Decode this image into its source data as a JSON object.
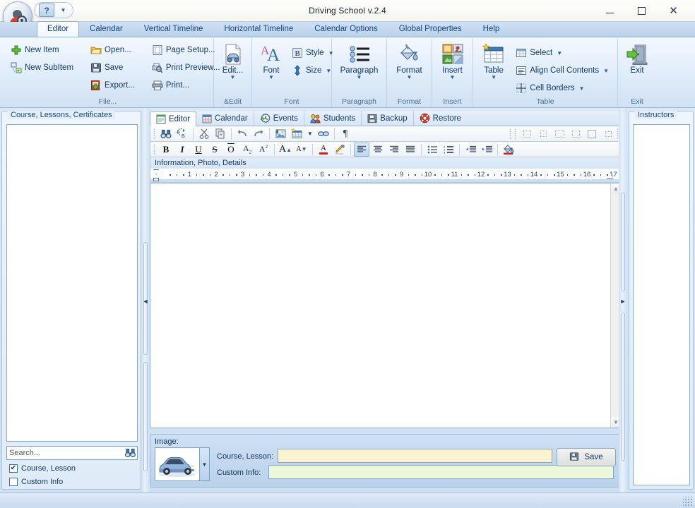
{
  "window": {
    "title": "Driving School v.2.4",
    "orb_icon": "app-orb-icon",
    "qat": {
      "help_label": "?",
      "help_icon": "help-icon",
      "dropdown_icon": "chevron-down-icon"
    },
    "controls": {
      "minimize": "Minimize",
      "maximize": "Maximize",
      "close": "Close"
    }
  },
  "ribbon": {
    "tabs": [
      {
        "label": "Editor",
        "active": true
      },
      {
        "label": "Calendar",
        "active": false
      },
      {
        "label": "Vertical Timeline",
        "active": false
      },
      {
        "label": "Horizontal Timeline",
        "active": false
      },
      {
        "label": "Calendar Options",
        "active": false
      },
      {
        "label": "Global Properties",
        "active": false
      },
      {
        "label": "Help",
        "active": false
      }
    ],
    "groups": [
      {
        "title": "File...",
        "col1": [
          {
            "label": "New Item",
            "icon": "plus-icon"
          },
          {
            "label": "New SubItem",
            "icon": "subitem-icon"
          }
        ],
        "col2": [
          {
            "label": "Open...",
            "icon": "folder-open-icon"
          },
          {
            "label": "Save",
            "icon": "floppy-disk-icon"
          },
          {
            "label": "Export...",
            "icon": "export-icon"
          }
        ],
        "col3": [
          {
            "label": "Page Setup...",
            "icon": "page-setup-icon"
          },
          {
            "label": "Print Preview...",
            "icon": "print-preview-icon"
          },
          {
            "label": "Print...",
            "icon": "printer-icon"
          }
        ]
      },
      {
        "title": "&Edit",
        "big": [
          {
            "label": "Edit...",
            "icon": "edit-document-icon",
            "split": true
          }
        ]
      },
      {
        "title": "Font",
        "big": [
          {
            "label": "Font",
            "icon": "font-AA-icon",
            "split": true
          }
        ],
        "col2": [
          {
            "label": "Style",
            "icon": "style-B-icon",
            "caret": true
          },
          {
            "label": "Size",
            "icon": "size-arrows-icon",
            "caret": true
          }
        ]
      },
      {
        "title": "Paragraph",
        "big": [
          {
            "label": "Paragraph",
            "icon": "paragraph-list-icon",
            "split": true
          }
        ]
      },
      {
        "title": "Format",
        "big": [
          {
            "label": "Format",
            "icon": "paint-bucket-icon",
            "split": true
          }
        ]
      },
      {
        "title": "Insert",
        "big": [
          {
            "label": "Insert",
            "icon": "insert-objects-icon",
            "split": true
          }
        ]
      },
      {
        "title": "Table",
        "big": [
          {
            "label": "Table",
            "icon": "table-grid-icon",
            "split": true
          }
        ],
        "col2": [
          {
            "label": "Select",
            "icon": "select-table-icon",
            "caret": true
          },
          {
            "label": "Align Cell Contents",
            "icon": "align-cell-icon",
            "caret": true
          },
          {
            "label": "Cell Borders",
            "icon": "cell-borders-icon",
            "caret": true
          }
        ]
      },
      {
        "title": "Exit",
        "big": [
          {
            "label": "Exit",
            "icon": "exit-door-icon",
            "split": false
          }
        ]
      }
    ]
  },
  "left_panel": {
    "title": "Course, Lessons, Certificates",
    "search": {
      "placeholder": "Search...",
      "value": "",
      "icon": "binoculars-icon"
    },
    "checkboxes": [
      {
        "label": "Course, Lesson",
        "checked": true,
        "mark": "✔"
      },
      {
        "label": "Custom Info",
        "checked": false,
        "mark": ""
      }
    ]
  },
  "right_panel": {
    "title": "Instructors"
  },
  "splitters": {
    "left_arrow": "◄",
    "right_arrow": "►"
  },
  "center": {
    "tabs": [
      {
        "label": "Editor",
        "icon": "editor-icon",
        "active": true
      },
      {
        "label": "Calendar",
        "icon": "calendar-icon",
        "active": false
      },
      {
        "label": "Events",
        "icon": "events-clock-icon",
        "active": false
      },
      {
        "label": "Students",
        "icon": "students-icon",
        "active": false
      },
      {
        "label": "Backup",
        "icon": "backup-floppy-icon",
        "active": false
      },
      {
        "label": "Restore",
        "icon": "restore-lifering-icon",
        "active": false
      }
    ],
    "toolbar_row1": [
      {
        "name": "find-icon",
        "title": "Find"
      },
      {
        "name": "replace-icon",
        "title": "Replace"
      },
      {
        "sep": true
      },
      {
        "name": "cut-icon",
        "title": "Cut"
      },
      {
        "name": "copy-icon",
        "title": "Copy"
      },
      {
        "sep": true
      },
      {
        "name": "undo-icon",
        "title": "Undo"
      },
      {
        "name": "redo-icon",
        "title": "Redo"
      },
      {
        "sep": true
      },
      {
        "name": "insert-image-icon",
        "title": "Insert Image"
      },
      {
        "name": "insert-table-icon",
        "title": "Insert Table"
      },
      {
        "name": "table-dropdown-icon",
        "title": "Table Options"
      },
      {
        "name": "insert-link-icon",
        "title": "Insert Hyperlink"
      },
      {
        "sep": true
      },
      {
        "name": "pilcrow-icon",
        "title": "Show Formatting Marks"
      }
    ],
    "toolbar_row1_right": [
      {
        "name": "border-none-icon"
      },
      {
        "name": "border-box-icon"
      },
      {
        "name": "border-wide-icon"
      },
      {
        "name": "border-dash-icon"
      },
      {
        "name": "border-solid-icon"
      },
      {
        "name": "border-small-icon"
      }
    ],
    "toolbar_row2": [
      {
        "name": "bold-icon",
        "glyph": "B",
        "title": "Bold"
      },
      {
        "name": "italic-icon",
        "glyph": "I",
        "title": "Italic"
      },
      {
        "name": "underline-icon",
        "glyph": "U",
        "title": "Underline"
      },
      {
        "name": "strikethrough-icon",
        "glyph": "S",
        "title": "Strikethrough"
      },
      {
        "name": "overline-icon",
        "glyph": "O",
        "title": "Overline"
      },
      {
        "name": "subscript-icon",
        "glyph": "A",
        "title": "Subscript"
      },
      {
        "name": "superscript-icon",
        "glyph": "A",
        "title": "Superscript"
      },
      {
        "sep": true
      },
      {
        "name": "grow-font-icon",
        "glyph": "A",
        "title": "Grow Font"
      },
      {
        "name": "shrink-font-icon",
        "glyph": "A",
        "title": "Shrink Font"
      },
      {
        "sep": true
      },
      {
        "name": "font-color-icon",
        "glyph": "A",
        "title": "Font Color"
      },
      {
        "name": "highlight-icon",
        "glyph": "",
        "title": "Text Highlight"
      },
      {
        "sep": true
      },
      {
        "name": "align-left-icon",
        "title": "Align Left",
        "active": true
      },
      {
        "name": "align-center-icon",
        "title": "Center"
      },
      {
        "name": "align-right-icon",
        "title": "Align Right"
      },
      {
        "name": "align-justify-icon",
        "title": "Justify"
      },
      {
        "sep": true
      },
      {
        "name": "bullets-icon",
        "title": "Bullets"
      },
      {
        "name": "numbering-icon",
        "title": "Numbering"
      },
      {
        "sep": true
      },
      {
        "name": "decrease-indent-icon",
        "title": "Decrease Indent"
      },
      {
        "name": "increase-indent-icon",
        "title": "Increase Indent"
      },
      {
        "sep": true
      },
      {
        "name": "background-color-icon",
        "title": "Background Color"
      }
    ],
    "document_label": "Information, Photo, Details",
    "ruler": {
      "numbers": [
        1,
        2,
        3,
        4,
        5,
        6,
        7,
        8,
        9,
        10,
        11,
        12,
        13,
        14,
        15,
        16,
        17
      ],
      "right_indent_at": 17
    },
    "editor_content": ""
  },
  "bottom_panel": {
    "image_label": "Image:",
    "thumbnail_icon": "car-thumbnail",
    "thumbnail_dropdown_icon": "chevron-down-icon",
    "fields": [
      {
        "label": "Course, Lesson:",
        "value": "",
        "style": "yellow"
      },
      {
        "label": "Custom Info:",
        "value": "",
        "style": "green"
      }
    ],
    "save_button": {
      "label": "Save",
      "icon": "floppy-disk-icon"
    }
  },
  "colors": {
    "accent": "#16447a",
    "ribbon_top": "#f3f8fd",
    "ribbon_bottom": "#cfe1f3",
    "field_yellow": "#fbf3cf",
    "field_green": "#edf7da",
    "panel_blue": "#cfe0f3"
  }
}
